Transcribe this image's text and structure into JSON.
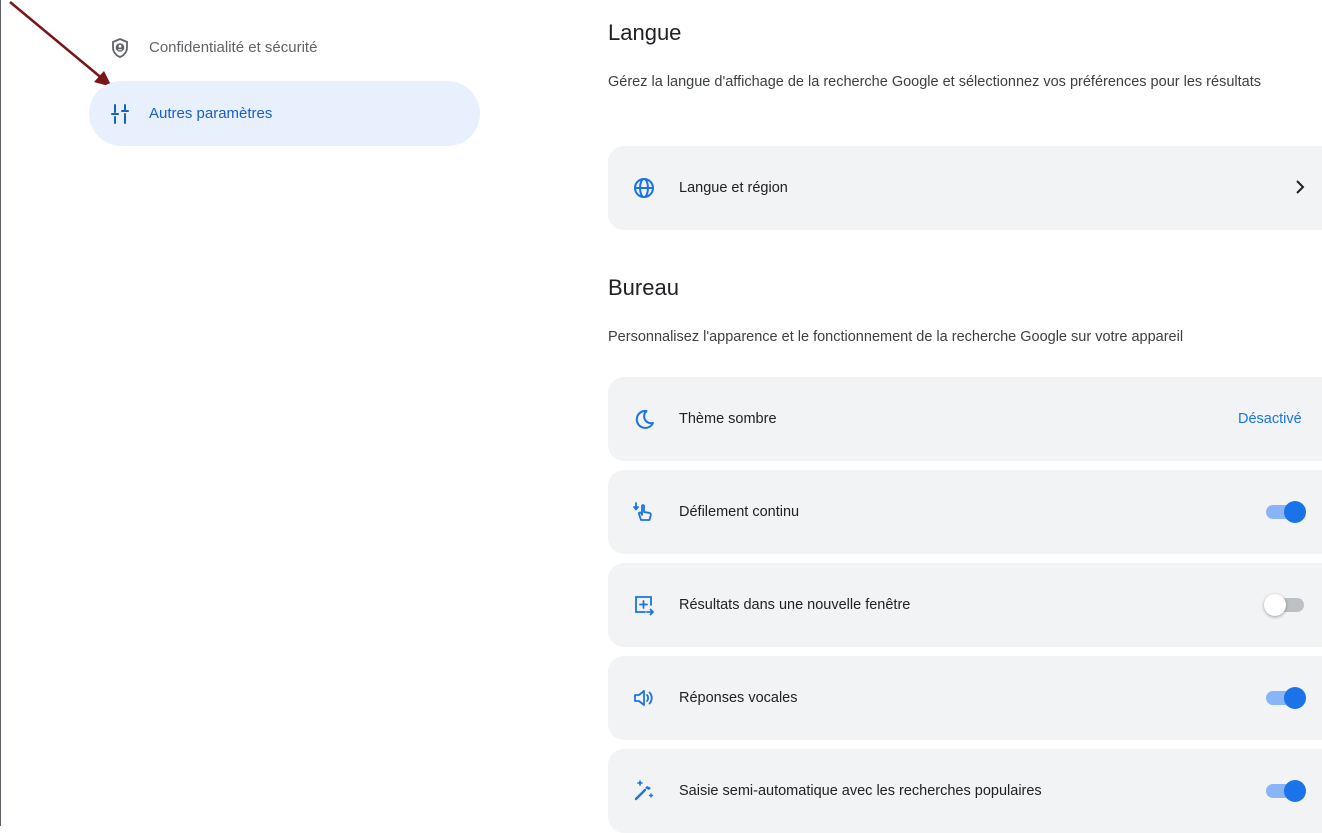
{
  "sidebar": {
    "items": [
      {
        "label": "Confidentialité et sécurité",
        "icon": "shield-icon",
        "active": false
      },
      {
        "label": "Autres paramètres",
        "icon": "tune-icon",
        "active": true
      }
    ]
  },
  "language_section": {
    "title": "Langue",
    "description": "Gérez la langue d'affichage de la recherche Google et sélectionnez vos préférences pour les résultats",
    "card": {
      "label": "Langue et région",
      "icon": "globe-icon"
    }
  },
  "desktop_section": {
    "title": "Bureau",
    "description": "Personnalisez l'apparence et le fonctionnement de la recherche Google sur votre appareil",
    "settings": [
      {
        "label": "Thème sombre",
        "icon": "moon-icon",
        "status": "Désactivé"
      },
      {
        "label": "Défilement continu",
        "icon": "scroll-gesture-icon",
        "enabled": true
      },
      {
        "label": "Résultats dans une nouvelle fenêtre",
        "icon": "new-window-icon",
        "enabled": false
      },
      {
        "label": "Réponses vocales",
        "icon": "speaker-icon",
        "enabled": true
      },
      {
        "label": "Saisie semi-automatique avec les recherches populaires",
        "icon": "magic-wand-icon",
        "enabled": true
      }
    ]
  },
  "colors": {
    "accent": "#1a73e8",
    "active_bg": "#e8f0fe",
    "card_bg": "#f1f3f4",
    "annotation_arrow": "#7b1416"
  }
}
